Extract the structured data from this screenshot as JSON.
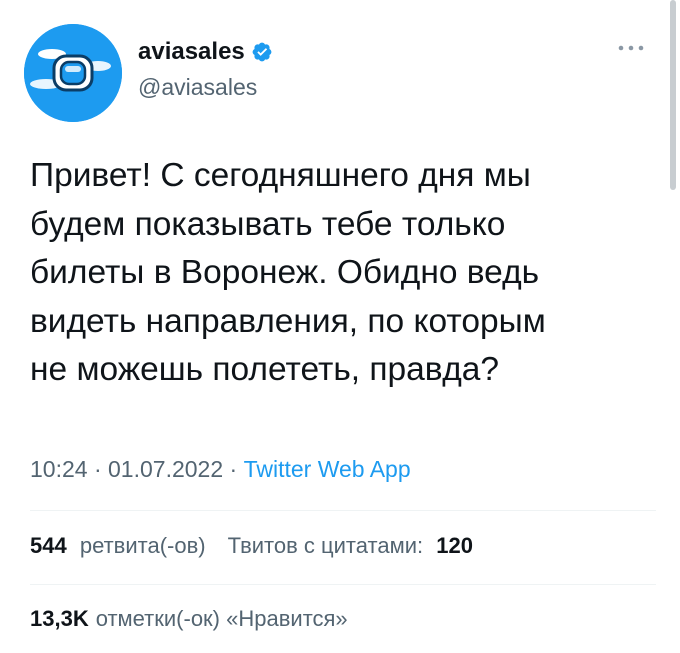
{
  "author": {
    "display_name": "aviasales",
    "handle": "@aviasales",
    "avatar_icon": "aviasales-logo",
    "verified": true,
    "accent_color": "#1d9bf0"
  },
  "tweet": {
    "text": "Привет! С сегодняшнего дня мы\nбудем показывать тебе только\nбилеты в Воронеж. Обидно ведь\nвидеть направления, по которым\nне можешь полететь, правда?"
  },
  "meta": {
    "time": "10:24",
    "separator": " · ",
    "date": "01.07.2022",
    "source": "Twitter Web App"
  },
  "stats": {
    "retweets_count": "544",
    "retweets_label": "ретвита(-ов)",
    "quotes_label": "Твитов с цитатами:",
    "quotes_count": "120",
    "likes_count": "13,3K",
    "likes_label": "отметки(-ок) «Нравится»"
  },
  "more_icon": "more-dots-icon"
}
